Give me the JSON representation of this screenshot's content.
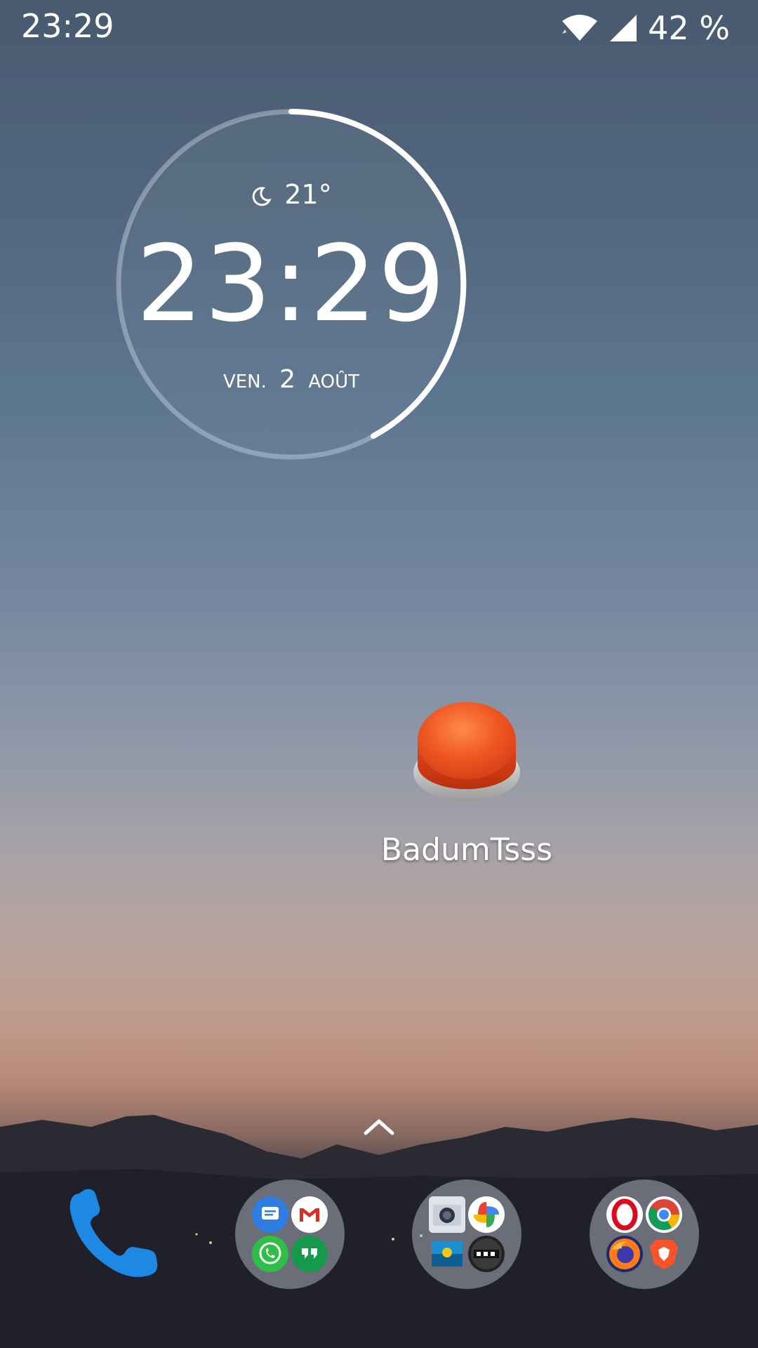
{
  "status_bar": {
    "time": "23:29",
    "battery": "42 %",
    "icons": [
      "wifi-icon",
      "signal-icon"
    ]
  },
  "clock_widget": {
    "weather_icon": "moon-icon",
    "temperature": "21°",
    "time": "23:29",
    "day": "VEN.",
    "date_num": "2",
    "month": "AOÛT"
  },
  "home_app": {
    "label": "BadumTsss",
    "icon": "red-button-icon"
  },
  "dock": {
    "phone": {
      "icon": "phone-icon"
    },
    "folder_messaging": {
      "apps": [
        "messages-icon",
        "gmail-icon",
        "whatsapp-icon",
        "hangouts-icon"
      ]
    },
    "folder_media": {
      "apps": [
        "camera-icon",
        "photos-icon",
        "gallery-icon",
        "gopro-icon"
      ]
    },
    "folder_browsers": {
      "apps": [
        "opera-icon",
        "chrome-icon",
        "firefox-icon",
        "brave-icon"
      ]
    }
  },
  "colors": {
    "accent_blue": "#1e88e5",
    "button_red": "#e8461e"
  }
}
